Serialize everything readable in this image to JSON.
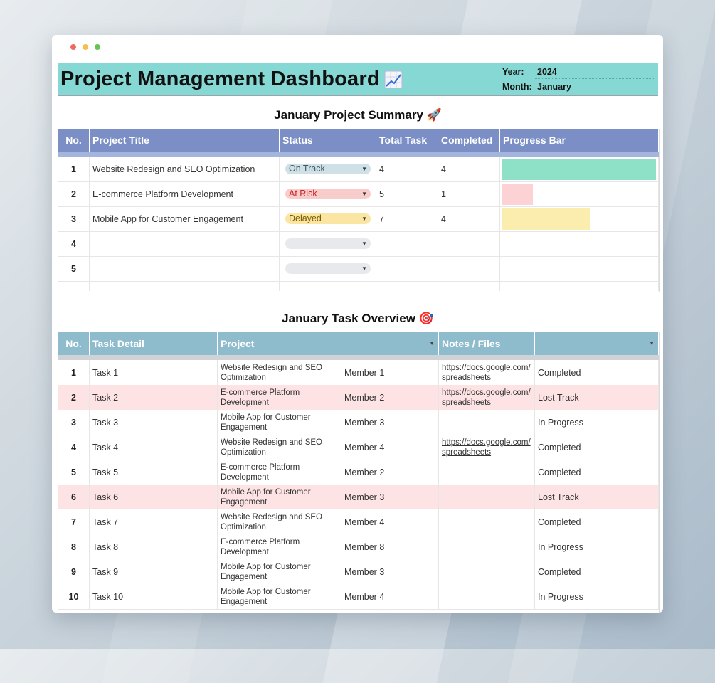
{
  "dashboard": {
    "title": "Project Management Dashboard",
    "title_icon": "chart-increasing-icon",
    "year_label": "Year:",
    "year_value": "2024",
    "month_label": "Month:",
    "month_value": "January"
  },
  "summary": {
    "title": "January Project Summary 🚀",
    "headers": [
      "No.",
      "Project Title",
      "Status",
      "Total Task",
      "Completed",
      "Progress Bar"
    ],
    "rows": [
      {
        "no": "1",
        "title": "Website Redesign and SEO Optimization",
        "status": "On Track",
        "total": "4",
        "completed": "4",
        "progress": 1.0,
        "status_bg": "#cfe0e6",
        "status_fg": "#3d5a66",
        "bar_color": "#8ee0c6"
      },
      {
        "no": "2",
        "title": "E-commerce Platform Development",
        "status": "At Risk",
        "total": "5",
        "completed": "1",
        "progress": 0.2,
        "status_bg": "#f9cccc",
        "status_fg": "#cc2222",
        "bar_color": "#fdd2d4"
      },
      {
        "no": "3",
        "title": "Mobile App for Customer Engagement",
        "status": "Delayed",
        "total": "7",
        "completed": "4",
        "progress": 0.571,
        "status_bg": "#fbe5a3",
        "status_fg": "#7a5a00",
        "bar_color": "#fbedad"
      },
      {
        "no": "4",
        "title": "",
        "status": "",
        "total": "",
        "completed": "",
        "progress": 0,
        "status_bg": "#e8e9ec",
        "status_fg": "#333",
        "bar_color": "#ffffff"
      },
      {
        "no": "5",
        "title": "",
        "status": "",
        "total": "",
        "completed": "",
        "progress": 0,
        "status_bg": "#e8e9ec",
        "status_fg": "#333",
        "bar_color": "#ffffff"
      }
    ]
  },
  "tasks": {
    "title": "January Task Overview 🎯",
    "headers": [
      "No.",
      "Task Detail",
      "Project",
      "",
      "Notes / Files",
      ""
    ],
    "rows": [
      {
        "no": "1",
        "task": "Task 1",
        "project": "Website Redesign and SEO Optimization",
        "member": "Member 1",
        "notes": "https://docs.google.com/spreadsheets",
        "status": "Completed",
        "highlight": false
      },
      {
        "no": "2",
        "task": "Task 2",
        "project": "E-commerce Platform Development",
        "member": "Member 2",
        "notes": "https://docs.google.com/spreadsheets",
        "status": "Lost Track",
        "highlight": true
      },
      {
        "no": "3",
        "task": "Task 3",
        "project": "Mobile App for Customer Engagement",
        "member": "Member 3",
        "notes": "",
        "status": "In Progress",
        "highlight": false
      },
      {
        "no": "4",
        "task": "Task 4",
        "project": "Website Redesign and SEO Optimization",
        "member": "Member 4",
        "notes": "https://docs.google.com/spreadsheets",
        "status": "Completed",
        "highlight": false
      },
      {
        "no": "5",
        "task": "Task 5",
        "project": "E-commerce Platform Development",
        "member": "Member 2",
        "notes": "",
        "status": "Completed",
        "highlight": false
      },
      {
        "no": "6",
        "task": "Task 6",
        "project": "Mobile App for Customer Engagement",
        "member": "Member 3",
        "notes": "",
        "status": "Lost Track",
        "highlight": true
      },
      {
        "no": "7",
        "task": "Task 7",
        "project": "Website Redesign and SEO Optimization",
        "member": "Member 4",
        "notes": "",
        "status": "Completed",
        "highlight": false
      },
      {
        "no": "8",
        "task": "Task 8",
        "project": "E-commerce Platform Development",
        "member": "Member 8",
        "notes": "",
        "status": "In Progress",
        "highlight": false
      },
      {
        "no": "9",
        "task": "Task 9",
        "project": "Mobile App for Customer Engagement",
        "member": "Member 3",
        "notes": "",
        "status": "Completed",
        "highlight": false
      },
      {
        "no": "10",
        "task": "Task 10",
        "project": "Mobile App for Customer Engagement",
        "member": "Member 4",
        "notes": "",
        "status": "In Progress",
        "highlight": false
      }
    ]
  },
  "colors": {
    "header_bg": "#86d8d4",
    "summary_header_bg": "#7b8fc6",
    "task_header_bg": "#8fbccd",
    "highlight_row": "#fde3e3"
  }
}
